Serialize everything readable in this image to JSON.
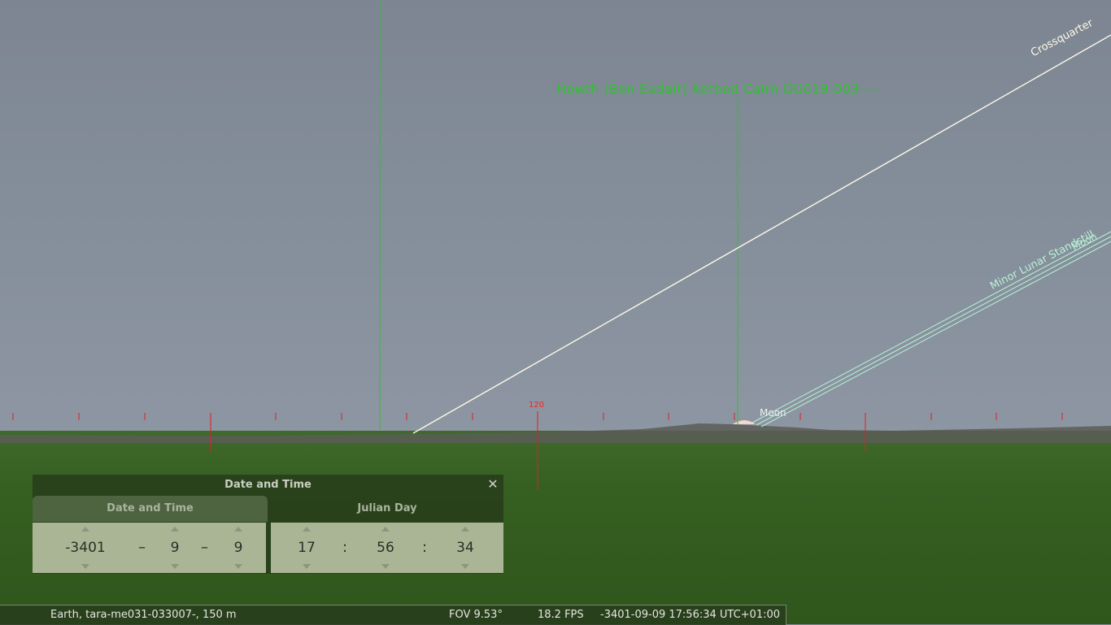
{
  "sky": {
    "deep_sky_object": "Howth (Ben Eadair) Kerbed Cairn DU019-003----",
    "moon_label": "Moon",
    "crossquarter_label": "Crossquarter",
    "minor_lunar_standstill_label": "Minor Lunar Standstill",
    "moon_line_label": "Moon",
    "azimuth_marker": "120"
  },
  "colors": {
    "dso": "#2fc12f",
    "crossquarter": "#fffbe6",
    "lunar_standstill": "#b8f2d4",
    "azimuth_grid": "#ff2020"
  },
  "dialog": {
    "title": "Date and Time",
    "close_icon": "close-icon",
    "tabs": [
      "Date and Time",
      "Julian Day"
    ],
    "date": {
      "year": "-3401",
      "month": "9",
      "day": "9",
      "sep": "–"
    },
    "time": {
      "hour": "17",
      "minute": "56",
      "second": "34",
      "sep": ":"
    }
  },
  "status_bar": {
    "location": "Earth, tara-me031-033007-, 150 m",
    "fov": "FOV 9.53°",
    "fps": "18.2 FPS",
    "datetime": "-3401-09-09 17:56:34 UTC+01:00"
  }
}
